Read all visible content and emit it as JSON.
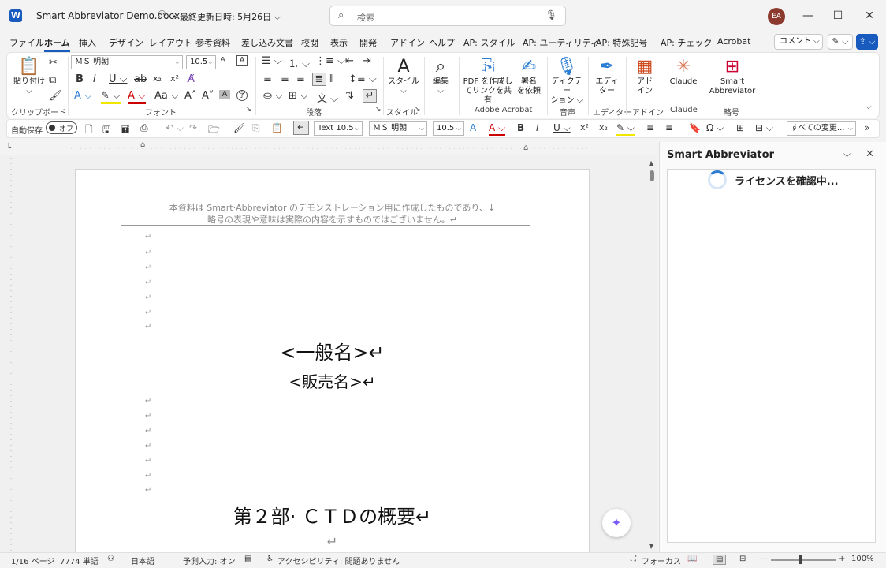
{
  "titlebar": {
    "logo": "W",
    "doc_title": "Smart Abbreviator Demo.docx",
    "person_icon": "person-icon",
    "last_modified": "• 最終更新日時: 5月26日 ⌵",
    "search_placeholder": "検索",
    "avatar": "EA",
    "minimize": "—",
    "maximize": "☐",
    "close": "✕"
  },
  "tabs": [
    {
      "label": "ファイル"
    },
    {
      "label": "ホーム"
    },
    {
      "label": "挿入"
    },
    {
      "label": "デザイン"
    },
    {
      "label": "レイアウト"
    },
    {
      "label": "参考資料"
    },
    {
      "label": "差し込み文書"
    },
    {
      "label": "校閲"
    },
    {
      "label": "表示"
    },
    {
      "label": "開発"
    },
    {
      "label": "アドイン"
    },
    {
      "label": "ヘルプ"
    },
    {
      "label": "AP: スタイル"
    },
    {
      "label": "AP: ユーティリティ"
    },
    {
      "label": "AP: 特殊記号"
    },
    {
      "label": "AP: チェック"
    },
    {
      "label": "Acrobat"
    }
  ],
  "tab_actions": {
    "comment": "コメント ⌵",
    "pen": "✎ ⌵",
    "share": "⇪ ⌵"
  },
  "ribbon": {
    "paste": "貼り付け",
    "clipboard": "クリップボード",
    "font_name": "ＭＳ 明朝",
    "font_size": "10.5",
    "font_group": "フォント",
    "paragraph_group": "段落",
    "style_btn": "スタイル",
    "style_group": "スタイル",
    "edit_btn": "編集",
    "pdf_btn_1": "PDF を作成し",
    "pdf_btn_2": "てリンクを共有",
    "sign_btn_1": "署名",
    "sign_btn_2": "を依頼",
    "acrobat_group": "Adobe Acrobat",
    "dictate_1": "ディクテー",
    "dictate_2": "ション ⌵",
    "voice_group": "音声",
    "editor_1": "エディ",
    "editor_2": "ター",
    "editor_group": "エディター",
    "addin_1": "アド",
    "addin_2": "イン",
    "addin_group": "アドイン",
    "claude_btn": "Claude",
    "claude_group": "Claude",
    "sa_1": "Smart",
    "sa_2": "Abbreviator",
    "abbr_group": "略号"
  },
  "qat": {
    "autosave": "自動保存",
    "toggle": "オフ",
    "style_select": "Text 10.5",
    "font_select": "ＭＳ 明朝",
    "size_select": "10.5",
    "track_select": "すべての変更..."
  },
  "document": {
    "header_line1": "本資料は Smart·Abbreviator のデモンストレーション用に作成したものであり、↓",
    "header_line2": "略号の表現や意味は実際の内容を示すものではございません。↵",
    "para_mark": "↵",
    "generic_name": "<一般名>↵",
    "brand_name": "<販売名>↵",
    "part_title": "第２部· ＣＴＤの概要↵"
  },
  "pane": {
    "title": "Smart Abbreviator",
    "status": "ライセンスを確認中..."
  },
  "status": {
    "page": "1/16 ページ",
    "words": "7774 単語",
    "language": "日本語",
    "predict": "予測入力: オン",
    "accessibility": "アクセシビリティ: 問題ありません",
    "focus": "フォーカス",
    "zoom": "100%",
    "zoom_minus": "—",
    "zoom_plus": "+"
  }
}
